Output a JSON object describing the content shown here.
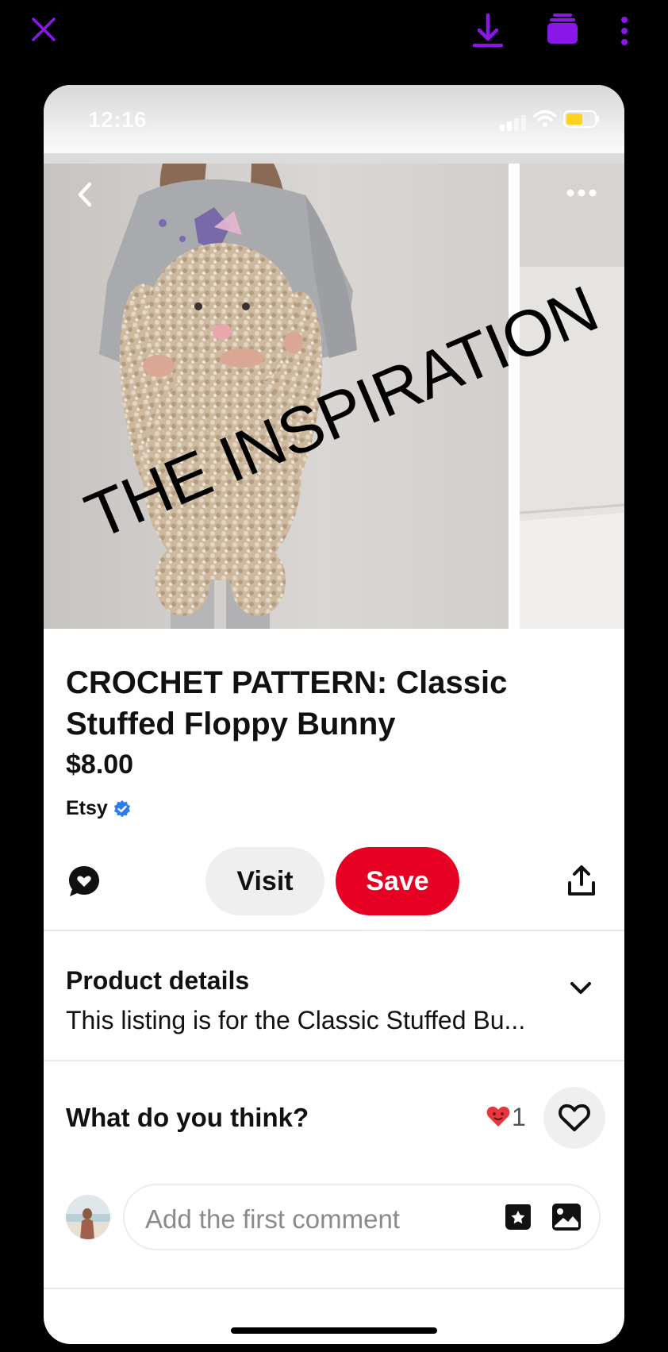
{
  "viewer": {
    "close_icon": "close-icon",
    "download_icon": "download-icon",
    "stack_icon": "stack-icon",
    "more_icon": "more-vertical-icon",
    "accent_color": "#8a17e8"
  },
  "status_bar": {
    "time": "12:16",
    "battery_color": "#ffd21f"
  },
  "pin": {
    "overlay_text": "THE INSPIRATION",
    "title": "CROCHET PATTERN: Classic Stuffed Floppy Bunny",
    "price": "$8.00",
    "merchant": "Etsy",
    "verified_color": "#2b7de9"
  },
  "actions": {
    "visit_label": "Visit",
    "save_label": "Save",
    "save_color": "#e60023"
  },
  "product_details": {
    "heading": "Product details",
    "description": "This listing is for the Classic Stuffed Bu..."
  },
  "feedback": {
    "prompt": "What do you think?",
    "reaction_count": "1"
  },
  "comment": {
    "placeholder": "Add the first comment"
  }
}
